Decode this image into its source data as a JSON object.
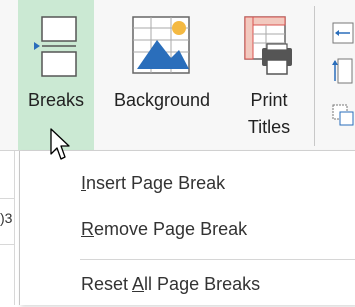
{
  "ribbon": {
    "buttons": [
      {
        "label": "Breaks",
        "icon": "breaks-icon",
        "active": true
      },
      {
        "label": "Background",
        "icon": "background-icon"
      },
      {
        "label_line1": "Print",
        "label_line2": "Titles",
        "icon": "print-titles-icon"
      }
    ]
  },
  "menu": {
    "items": [
      {
        "pre": "",
        "accel": "I",
        "post": "nsert Page Break"
      },
      {
        "pre": "",
        "accel": "R",
        "post": "emove Page Break"
      },
      {
        "pre": "Reset ",
        "accel": "A",
        "post": "ll Page Breaks"
      }
    ]
  },
  "sheet": {
    "cell_fragment": ")3"
  },
  "colors": {
    "active_button_bg": "#cbe9d3",
    "accent_green": "#217346",
    "icon_blue": "#2a6ebb"
  }
}
